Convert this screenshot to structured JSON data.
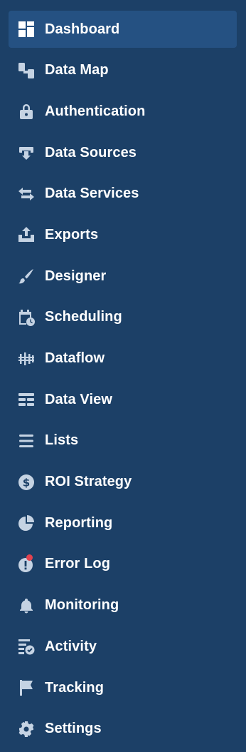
{
  "sidebar": {
    "active_item": "Dashboard",
    "accent_color": "#255182",
    "icon_color": "#c5d3e3",
    "badge_color": "#e2424f",
    "items": [
      {
        "label": "Dashboard",
        "icon": "dashboard-icon"
      },
      {
        "label": "Data Map",
        "icon": "data-map-icon"
      },
      {
        "label": "Authentication",
        "icon": "lock-icon"
      },
      {
        "label": "Data Sources",
        "icon": "data-sources-icon"
      },
      {
        "label": "Data Services",
        "icon": "swap-arrows-icon"
      },
      {
        "label": "Exports",
        "icon": "upload-tray-icon"
      },
      {
        "label": "Designer",
        "icon": "paintbrush-icon"
      },
      {
        "label": "Scheduling",
        "icon": "calendar-clock-icon"
      },
      {
        "label": "Dataflow",
        "icon": "dataflow-icon"
      },
      {
        "label": "Data View",
        "icon": "table-view-icon"
      },
      {
        "label": "Lists",
        "icon": "list-icon"
      },
      {
        "label": "ROI Strategy",
        "icon": "dollar-circle-icon"
      },
      {
        "label": "Reporting",
        "icon": "pie-chart-icon"
      },
      {
        "label": "Error Log",
        "icon": "error-alert-icon"
      },
      {
        "label": "Monitoring",
        "icon": "bell-icon"
      },
      {
        "label": "Activity",
        "icon": "activity-check-icon"
      },
      {
        "label": "Tracking",
        "icon": "flag-icon"
      },
      {
        "label": "Settings",
        "icon": "gear-icon"
      }
    ]
  }
}
